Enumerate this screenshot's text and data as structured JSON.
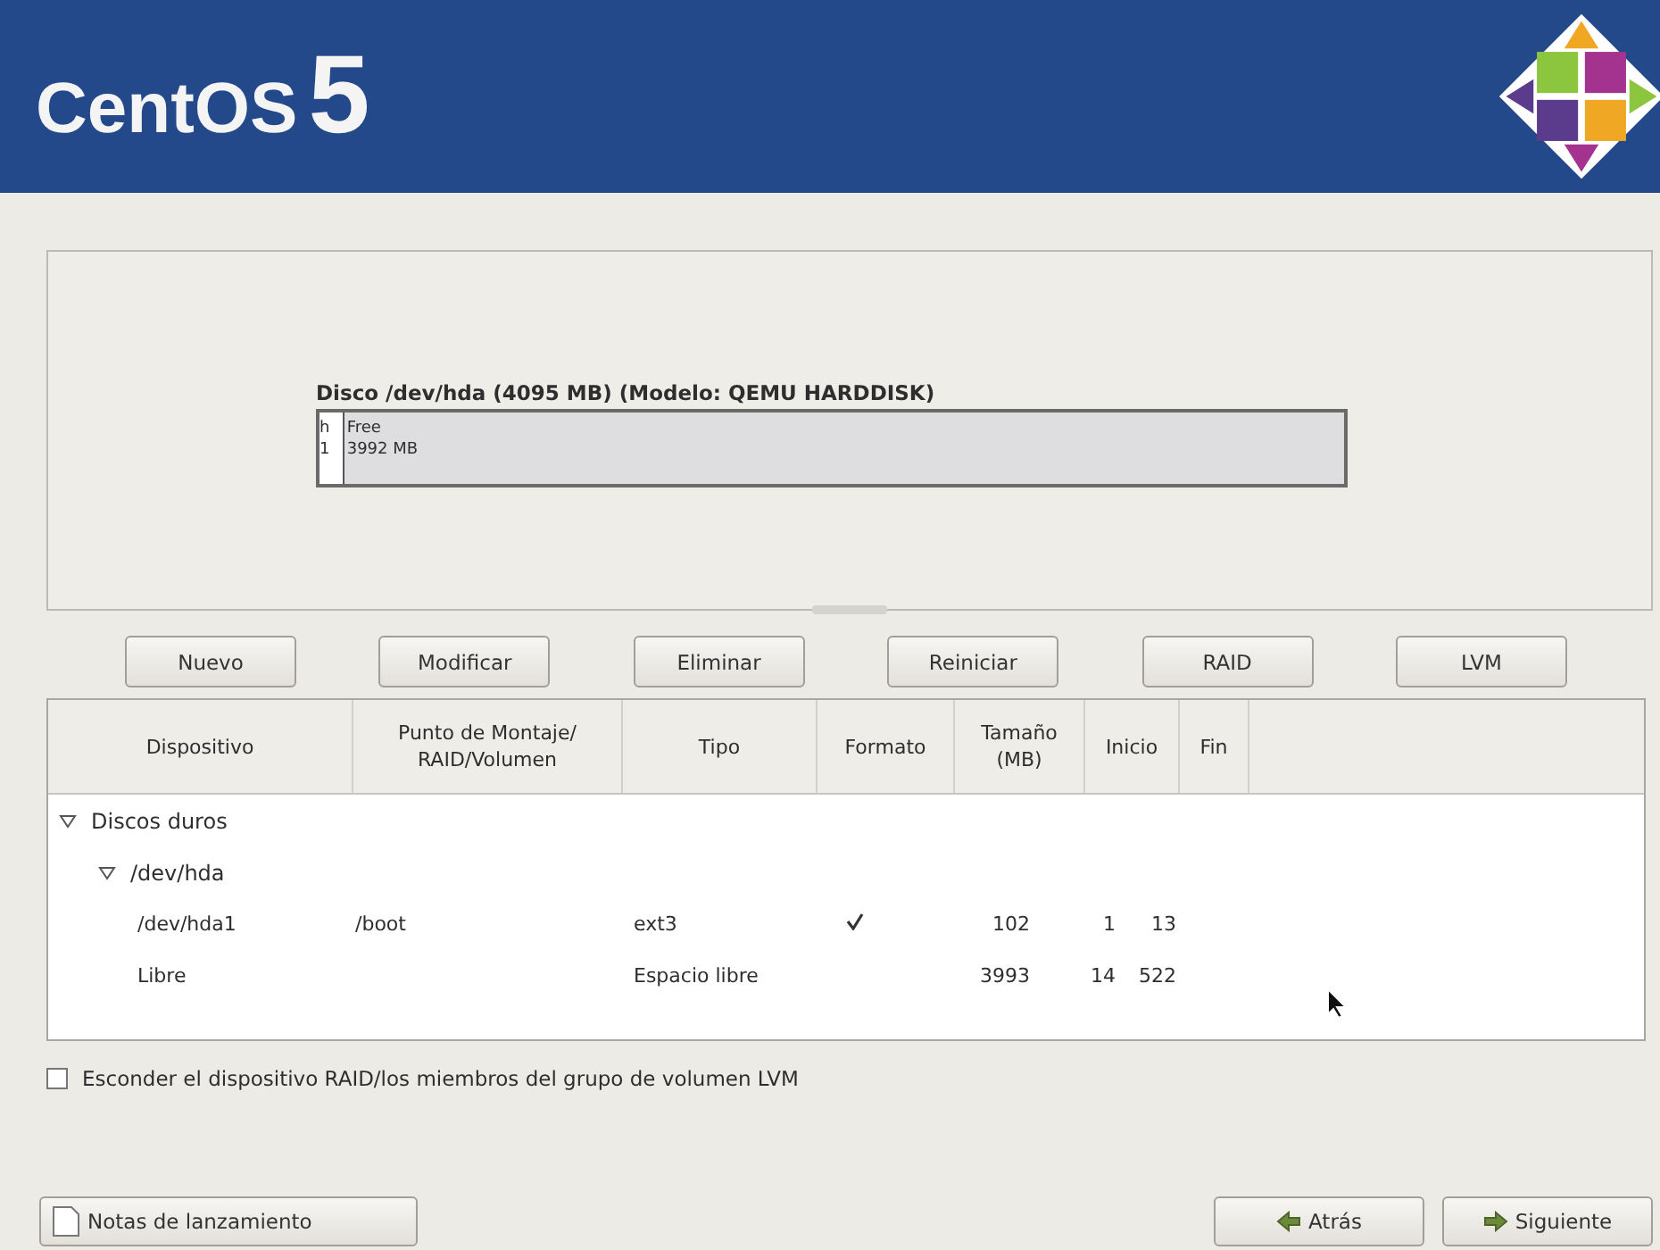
{
  "header": {
    "logo_text": "CentOS",
    "logo_version": "5"
  },
  "disk": {
    "title": "Disco /dev/hda (4095 MB) (Modelo: QEMU HARDDISK)",
    "segments": [
      {
        "label": "h",
        "size": "1",
        "kind": "used",
        "level": 0.025
      },
      {
        "label": "Free",
        "size": "3992 MB",
        "kind": "free",
        "level": 0.975
      }
    ]
  },
  "buttons": [
    "Nuevo",
    "Modificar",
    "Eliminar",
    "Reiniciar",
    "RAID",
    "LVM"
  ],
  "table": {
    "columns": [
      "Dispositivo",
      "Punto de Montaje/ RAID/Volumen",
      "Tipo",
      "Formato",
      "Tamaño (MB)",
      "Inicio",
      "Fin"
    ],
    "rows": [
      {
        "device": "Discos duros",
        "expanded": true,
        "children": [
          {
            "device": "/dev/hda",
            "expanded": true,
            "children": [
              {
                "device": "/dev/hda1",
                "mount": "/boot",
                "type": "ext3",
                "format": true,
                "size": "102",
                "start": "1",
                "end": "13"
              },
              {
                "device": "Libre",
                "type": "Espacio libre",
                "format": false,
                "size": "3993",
                "start": "14",
                "end": "522"
              }
            ]
          }
        ]
      }
    ]
  },
  "hide_raid": {
    "label": "Esconder el dispositivo RAID/los miembros del grupo de volumen LVM",
    "checked": false
  },
  "footer": {
    "release_notes": "Notas de lanzamiento",
    "back": "Atrás",
    "next": "Siguiente"
  }
}
